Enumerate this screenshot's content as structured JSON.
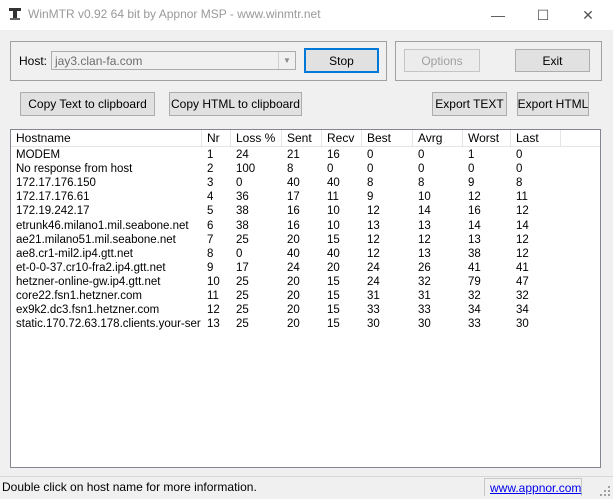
{
  "window": {
    "title": "WinMTR v0.92 64 bit by Appnor MSP - www.winmtr.net",
    "minimize_glyph": "—",
    "maximize_glyph": "☐",
    "close_glyph": "✕"
  },
  "host": {
    "label": "Host:",
    "value": "jay3.clan-fa.com",
    "dropdown_glyph": "▼"
  },
  "buttons": {
    "stop": "Stop",
    "options": "Options",
    "exit": "Exit",
    "copy_text": "Copy Text to clipboard",
    "copy_html": "Copy HTML to clipboard",
    "export_text": "Export TEXT",
    "export_html": "Export HTML"
  },
  "table": {
    "columns": [
      "Hostname",
      "Nr",
      "Loss %",
      "Sent",
      "Recv",
      "Best",
      "Avrg",
      "Worst",
      "Last"
    ],
    "rows": [
      [
        "MODEM",
        "1",
        "24",
        "21",
        "16",
        "0",
        "0",
        "1",
        "0"
      ],
      [
        "No response from host",
        "2",
        "100",
        "8",
        "0",
        "0",
        "0",
        "0",
        "0"
      ],
      [
        "172.17.176.150",
        "3",
        "0",
        "40",
        "40",
        "8",
        "8",
        "9",
        "8"
      ],
      [
        "172.17.176.61",
        "4",
        "36",
        "17",
        "11",
        "9",
        "10",
        "12",
        "11"
      ],
      [
        "172.19.242.17",
        "5",
        "38",
        "16",
        "10",
        "12",
        "14",
        "16",
        "12"
      ],
      [
        "etrunk46.milano1.mil.seabone.net",
        "6",
        "38",
        "16",
        "10",
        "13",
        "13",
        "14",
        "14"
      ],
      [
        "ae21.milano51.mil.seabone.net",
        "7",
        "25",
        "20",
        "15",
        "12",
        "12",
        "13",
        "12"
      ],
      [
        "ae8.cr1-mil2.ip4.gtt.net",
        "8",
        "0",
        "40",
        "40",
        "12",
        "13",
        "38",
        "12"
      ],
      [
        "et-0-0-37.cr10-fra2.ip4.gtt.net",
        "9",
        "17",
        "24",
        "20",
        "24",
        "26",
        "41",
        "41"
      ],
      [
        "hetzner-online-gw.ip4.gtt.net",
        "10",
        "25",
        "20",
        "15",
        "24",
        "32",
        "79",
        "47"
      ],
      [
        "core22.fsn1.hetzner.com",
        "11",
        "25",
        "20",
        "15",
        "31",
        "31",
        "32",
        "32"
      ],
      [
        "ex9k2.dc3.fsn1.hetzner.com",
        "12",
        "25",
        "20",
        "15",
        "33",
        "33",
        "34",
        "34"
      ],
      [
        "static.170.72.63.178.clients.your-ser...",
        "13",
        "25",
        "20",
        "15",
        "30",
        "30",
        "33",
        "30"
      ]
    ]
  },
  "status": {
    "text": "Double click on host name for more information.",
    "link": "www.appnor.com"
  }
}
